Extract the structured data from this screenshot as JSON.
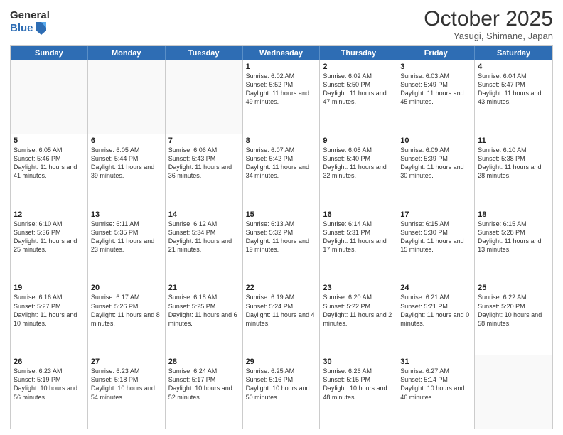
{
  "header": {
    "logo_general": "General",
    "logo_blue": "Blue",
    "month_title": "October 2025",
    "location": "Yasugi, Shimane, Japan"
  },
  "weekdays": [
    "Sunday",
    "Monday",
    "Tuesday",
    "Wednesday",
    "Thursday",
    "Friday",
    "Saturday"
  ],
  "rows": [
    [
      {
        "day": "",
        "text": ""
      },
      {
        "day": "",
        "text": ""
      },
      {
        "day": "",
        "text": ""
      },
      {
        "day": "1",
        "text": "Sunrise: 6:02 AM\nSunset: 5:52 PM\nDaylight: 11 hours and 49 minutes."
      },
      {
        "day": "2",
        "text": "Sunrise: 6:02 AM\nSunset: 5:50 PM\nDaylight: 11 hours and 47 minutes."
      },
      {
        "day": "3",
        "text": "Sunrise: 6:03 AM\nSunset: 5:49 PM\nDaylight: 11 hours and 45 minutes."
      },
      {
        "day": "4",
        "text": "Sunrise: 6:04 AM\nSunset: 5:47 PM\nDaylight: 11 hours and 43 minutes."
      }
    ],
    [
      {
        "day": "5",
        "text": "Sunrise: 6:05 AM\nSunset: 5:46 PM\nDaylight: 11 hours and 41 minutes."
      },
      {
        "day": "6",
        "text": "Sunrise: 6:05 AM\nSunset: 5:44 PM\nDaylight: 11 hours and 39 minutes."
      },
      {
        "day": "7",
        "text": "Sunrise: 6:06 AM\nSunset: 5:43 PM\nDaylight: 11 hours and 36 minutes."
      },
      {
        "day": "8",
        "text": "Sunrise: 6:07 AM\nSunset: 5:42 PM\nDaylight: 11 hours and 34 minutes."
      },
      {
        "day": "9",
        "text": "Sunrise: 6:08 AM\nSunset: 5:40 PM\nDaylight: 11 hours and 32 minutes."
      },
      {
        "day": "10",
        "text": "Sunrise: 6:09 AM\nSunset: 5:39 PM\nDaylight: 11 hours and 30 minutes."
      },
      {
        "day": "11",
        "text": "Sunrise: 6:10 AM\nSunset: 5:38 PM\nDaylight: 11 hours and 28 minutes."
      }
    ],
    [
      {
        "day": "12",
        "text": "Sunrise: 6:10 AM\nSunset: 5:36 PM\nDaylight: 11 hours and 25 minutes."
      },
      {
        "day": "13",
        "text": "Sunrise: 6:11 AM\nSunset: 5:35 PM\nDaylight: 11 hours and 23 minutes."
      },
      {
        "day": "14",
        "text": "Sunrise: 6:12 AM\nSunset: 5:34 PM\nDaylight: 11 hours and 21 minutes."
      },
      {
        "day": "15",
        "text": "Sunrise: 6:13 AM\nSunset: 5:32 PM\nDaylight: 11 hours and 19 minutes."
      },
      {
        "day": "16",
        "text": "Sunrise: 6:14 AM\nSunset: 5:31 PM\nDaylight: 11 hours and 17 minutes."
      },
      {
        "day": "17",
        "text": "Sunrise: 6:15 AM\nSunset: 5:30 PM\nDaylight: 11 hours and 15 minutes."
      },
      {
        "day": "18",
        "text": "Sunrise: 6:15 AM\nSunset: 5:28 PM\nDaylight: 11 hours and 13 minutes."
      }
    ],
    [
      {
        "day": "19",
        "text": "Sunrise: 6:16 AM\nSunset: 5:27 PM\nDaylight: 11 hours and 10 minutes."
      },
      {
        "day": "20",
        "text": "Sunrise: 6:17 AM\nSunset: 5:26 PM\nDaylight: 11 hours and 8 minutes."
      },
      {
        "day": "21",
        "text": "Sunrise: 6:18 AM\nSunset: 5:25 PM\nDaylight: 11 hours and 6 minutes."
      },
      {
        "day": "22",
        "text": "Sunrise: 6:19 AM\nSunset: 5:24 PM\nDaylight: 11 hours and 4 minutes."
      },
      {
        "day": "23",
        "text": "Sunrise: 6:20 AM\nSunset: 5:22 PM\nDaylight: 11 hours and 2 minutes."
      },
      {
        "day": "24",
        "text": "Sunrise: 6:21 AM\nSunset: 5:21 PM\nDaylight: 11 hours and 0 minutes."
      },
      {
        "day": "25",
        "text": "Sunrise: 6:22 AM\nSunset: 5:20 PM\nDaylight: 10 hours and 58 minutes."
      }
    ],
    [
      {
        "day": "26",
        "text": "Sunrise: 6:23 AM\nSunset: 5:19 PM\nDaylight: 10 hours and 56 minutes."
      },
      {
        "day": "27",
        "text": "Sunrise: 6:23 AM\nSunset: 5:18 PM\nDaylight: 10 hours and 54 minutes."
      },
      {
        "day": "28",
        "text": "Sunrise: 6:24 AM\nSunset: 5:17 PM\nDaylight: 10 hours and 52 minutes."
      },
      {
        "day": "29",
        "text": "Sunrise: 6:25 AM\nSunset: 5:16 PM\nDaylight: 10 hours and 50 minutes."
      },
      {
        "day": "30",
        "text": "Sunrise: 6:26 AM\nSunset: 5:15 PM\nDaylight: 10 hours and 48 minutes."
      },
      {
        "day": "31",
        "text": "Sunrise: 6:27 AM\nSunset: 5:14 PM\nDaylight: 10 hours and 46 minutes."
      },
      {
        "day": "",
        "text": ""
      }
    ]
  ]
}
